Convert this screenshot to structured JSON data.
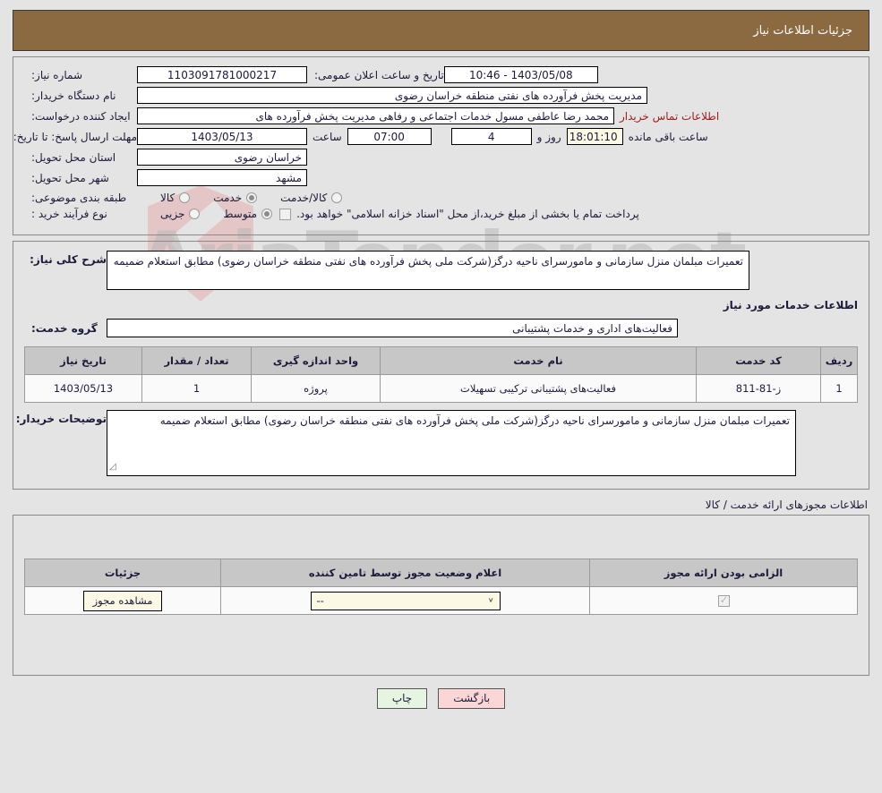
{
  "header": {
    "title": "جزئیات اطلاعات نیاز"
  },
  "watermark": {
    "text": "AriaTender.net"
  },
  "need": {
    "number_label": "شماره نیاز:",
    "number_value": "1103091781000217",
    "buyer_org_label": "نام دستگاه خریدار:",
    "buyer_org_value": "مدیریت پخش فرآورده های نفتی منطقه خراسان رضوی",
    "creator_label": "ایجاد کننده درخواست:",
    "creator_value": "محمد رضا عاطفی مسول خدمات اجتماعی و رفاهی مدیریت پخش فرآورده های ",
    "contact_link": "اطلاعات تماس خریدار",
    "announce_label": "تاریخ و ساعت اعلان عمومی:",
    "announce_value": "1403/05/08 - 10:46",
    "deadline_label": "مهلت ارسال پاسخ: تا تاریخ:",
    "deadline_date": "1403/05/13",
    "deadline_hour_label": "ساعت",
    "deadline_hour": "07:00",
    "remain_days": "4",
    "remain_days_label": "روز و",
    "remain_time": "18:01:10",
    "remain_suffix": "ساعت باقی مانده",
    "province_label": "استان محل تحویل:",
    "province_value": "خراسان رضوی",
    "city_label": "شهر محل تحویل:",
    "city_value": "مشهد",
    "category_label": "طبقه بندی موضوعی:",
    "category_options": [
      {
        "label": "کالا",
        "selected": false
      },
      {
        "label": "خدمت",
        "selected": true
      },
      {
        "label": "کالا/خدمت",
        "selected": false
      }
    ],
    "process_label": "نوع فرآیند خرید :",
    "process_options": [
      {
        "label": "جزیی",
        "selected": false
      },
      {
        "label": "متوسط",
        "selected": true
      }
    ],
    "treasury_checked": false,
    "treasury_note": "پرداخت تمام یا بخشی از مبلغ خرید،از محل \"اسناد خزانه اسلامی\" خواهد بود."
  },
  "description": {
    "label": "شرح کلی نیاز:",
    "value": "تعمیرات مبلمان منزل سازمانی و مامورسرای ناحیه درگز(شرکت ملی پخش فرآورده های نفتی منطقه خراسان رضوی) مطابق استعلام ضمیمه"
  },
  "services_section": {
    "title": "اطلاعات خدمات مورد نیاز",
    "group_label": "گروه خدمت:",
    "group_value": "فعالیت‌های اداری و خدمات پشتیبانی",
    "columns": [
      "ردیف",
      "کد خدمت",
      "نام خدمت",
      "واحد اندازه گیری",
      "تعداد / مقدار",
      "تاریخ نیاز"
    ],
    "rows": [
      {
        "index": "1",
        "code": "ز-81-811",
        "name": "فعالیت‌های پشتیبانی ترکیبی تسهیلات",
        "unit": "پروژه",
        "quantity": "1",
        "date": "1403/05/13"
      }
    ]
  },
  "buyer_notes": {
    "label": "توضیحات خریدار:",
    "value": "تعمیرات مبلمان منزل سازمانی و مامورسرای ناحیه درگز(شرکت ملی پخش فرآورده های نفتی منطقه خراسان رضوی) مطابق استعلام ضمیمه"
  },
  "permits": {
    "title": "اطلاعات مجوزهای ارائه خدمت / کالا",
    "columns": [
      "الزامی بودن ارائه مجوز",
      "اعلام وضعیت مجوز توسط تامین کننده",
      "جزئیات"
    ],
    "rows": [
      {
        "required_checked": true,
        "status_value": "--",
        "details_button": "مشاهده مجوز"
      }
    ]
  },
  "footer": {
    "print_label": "چاپ",
    "back_label": "بازگشت"
  }
}
